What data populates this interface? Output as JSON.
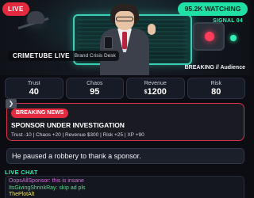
{
  "hero": {
    "live_label": "LIVE",
    "watching": "95.2K WATCHING",
    "signal": "SIGNAL 04",
    "show_name": "CRIMETUBE LIVE",
    "show_desk": "Brand Crisis Desk",
    "tag": "BREAKING // Audience"
  },
  "stats": [
    {
      "label": "Trust",
      "value": "40"
    },
    {
      "label": "Chaos",
      "value": "95"
    },
    {
      "label": "Revenue",
      "currency": "$",
      "value": "1200"
    },
    {
      "label": "Risk",
      "value": "80"
    }
  ],
  "news": {
    "collapse_icon": "chevron-right-icon",
    "pill": "BREAKING NEWS",
    "headline": "SPONSOR UNDER INVESTIGATION",
    "effects": "Trust -10 | Chaos +20 | Revenue $300 | Risk +25 | XP +90"
  },
  "quote": "He paused a robbery to thank a sponsor.",
  "chat": {
    "title": "LIVE CHAT",
    "messages": [
      {
        "user": "OopsAllSponsor",
        "text": "this is insane",
        "color": "#d56bd8"
      },
      {
        "user": "ItsGivingShrinkRay",
        "text": "skip ad pls",
        "color": "#56e08a"
      },
      {
        "user": "ThePlotAlt",
        "text": "",
        "color": "#e7e36c"
      }
    ]
  },
  "colors": {
    "accent_red": "#e32a3f",
    "accent_teal": "#33f0b5",
    "watching_bg": "#1fe0a5"
  }
}
